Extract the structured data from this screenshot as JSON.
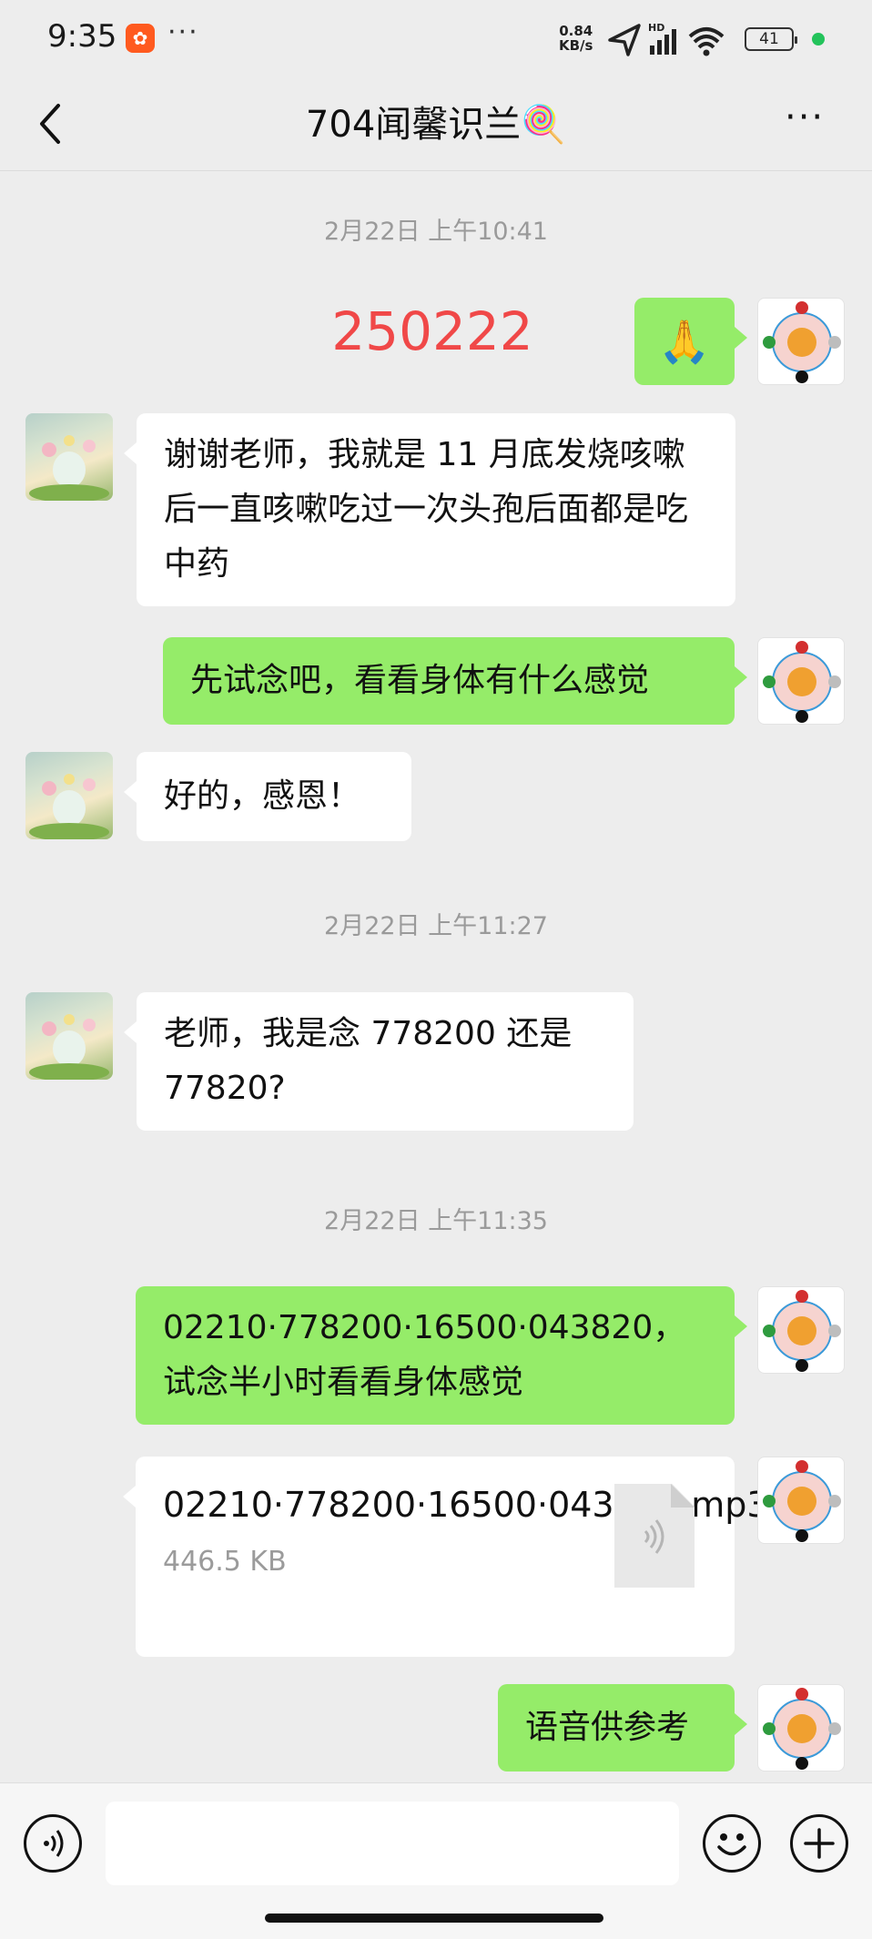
{
  "status_bar": {
    "time": "9:35",
    "network_speed_value": "0.84",
    "network_speed_unit": "KB/s",
    "network_badge": "HD",
    "battery": "41",
    "icons": [
      "location-arrow-icon",
      "signal-icon",
      "wifi-icon",
      "battery-icon"
    ]
  },
  "header": {
    "back_icon": "chevron-left-icon",
    "title": "704闻馨识兰🍭",
    "more_icon": "more-dots-icon"
  },
  "messages": [
    {
      "type": "time",
      "text": "2月22日 上午10:41"
    },
    {
      "type": "text",
      "dir": "out",
      "text": "250222"
    },
    {
      "type": "emoji",
      "dir": "out",
      "text": "🙏"
    },
    {
      "type": "text",
      "dir": "in",
      "text": "谢谢老师，我就是 11 月底发烧咳嗽后一直咳嗽吃过一次头孢后面都是吃中药"
    },
    {
      "type": "text",
      "dir": "out",
      "text": "先试念吧，看看身体有什么感觉"
    },
    {
      "type": "text",
      "dir": "in",
      "text": "好的，感恩！"
    },
    {
      "type": "time",
      "text": "2月22日 上午11:27"
    },
    {
      "type": "text",
      "dir": "in",
      "text": "老师，我是念 778200 还是 77820?"
    },
    {
      "type": "time",
      "text": "2月22日 上午11:35"
    },
    {
      "type": "text",
      "dir": "out",
      "text": "02210·778200·16500·043820，试念半小时看看身体感觉"
    },
    {
      "type": "file",
      "dir": "out",
      "name": "02210·778200·16500·043820.mp3",
      "size": "446.5 KB"
    },
    {
      "type": "text",
      "dir": "out",
      "text": "语音供参考"
    }
  ],
  "input_bar": {
    "voice_icon": "voice-icon",
    "input_value": "",
    "emoji_icon": "emoji-icon",
    "plus_icon": "plus-icon"
  },
  "colors": {
    "background": "#ededed",
    "out_bubble": "#95ec69",
    "in_bubble": "#ffffff",
    "accent_red": "#f04848"
  }
}
